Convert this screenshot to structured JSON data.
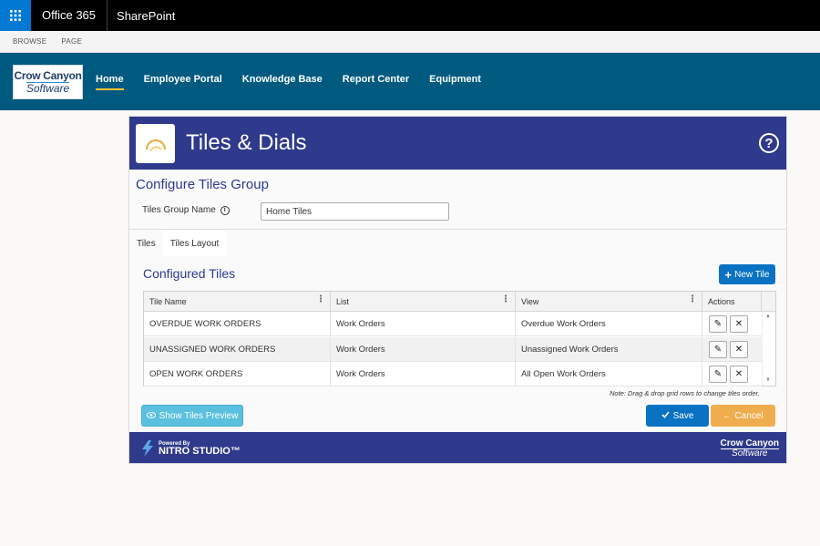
{
  "suitebar": {
    "app_launcher_icon": "waffle-icon",
    "suite_name": "Office 365",
    "site_name": "SharePoint"
  },
  "ribbon": {
    "tabs": [
      "BROWSE",
      "PAGE"
    ]
  },
  "topnav": {
    "logo": {
      "line1": "Crow Canyon",
      "line2": "Software"
    },
    "links": [
      {
        "label": "Home",
        "active": true
      },
      {
        "label": "Employee Portal"
      },
      {
        "label": "Knowledge Base"
      },
      {
        "label": "Report Center"
      },
      {
        "label": "Equipment"
      }
    ]
  },
  "app": {
    "title": "Tiles & Dials",
    "help_label": "?",
    "section_title": "Configure Tiles Group",
    "group_name_label": "Tiles Group Name",
    "group_name_value": "Home Tiles",
    "tabs": [
      {
        "label": "Tiles",
        "active": false
      },
      {
        "label": "Tiles Layout",
        "active": true
      }
    ],
    "configured_title": "Configured Tiles",
    "new_tile_label": "New Tile",
    "grid": {
      "columns": [
        "Tile Name",
        "List",
        "View",
        "Actions"
      ],
      "rows": [
        {
          "name": "OVERDUE WORK ORDERS",
          "list": "Work Orders",
          "view": "Overdue Work Orders"
        },
        {
          "name": "UNASSIGNED WORK ORDERS",
          "list": "Work Orders",
          "view": "Unassigned Work Orders"
        },
        {
          "name": "OPEN WORK ORDERS",
          "list": "Work Orders",
          "view": "All Open Work Orders"
        }
      ]
    },
    "note": "Note: Drag & drop grid rows to change tiles order.",
    "preview_label": "Show Tiles Preview",
    "save_label": "Save",
    "cancel_label": "Cancel",
    "footer": {
      "powered_by": "Powered By",
      "product": "NITRO STUDIO™",
      "brand_line1": "Crow Canyon",
      "brand_line2": "Software"
    }
  },
  "colors": {
    "nav_bg": "#005a80",
    "app_header": "#303a8c",
    "primary_button": "#0a72c2",
    "cancel_button": "#f0ad4e",
    "preview_button": "#5bc0de",
    "active_underline": "#ffc533"
  }
}
